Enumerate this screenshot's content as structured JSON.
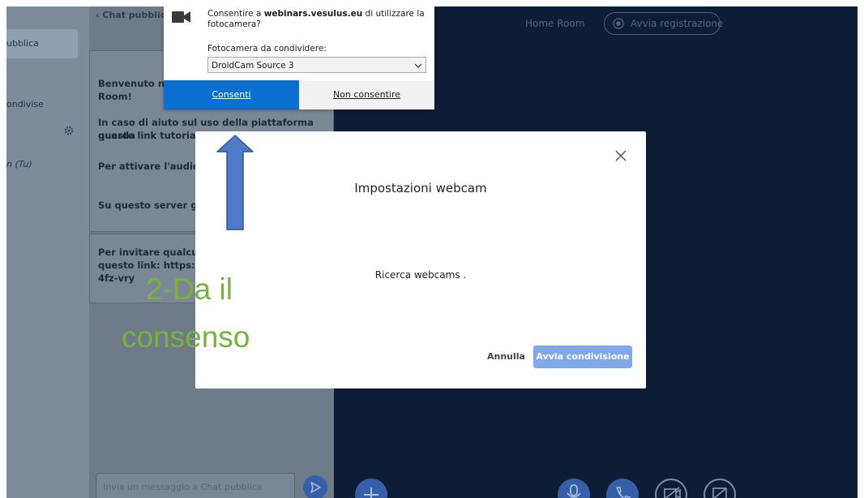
{
  "sidebar": {
    "chat_label": "ubblica",
    "notes_label": "ondivise",
    "user_label": "n (Tu)"
  },
  "chat": {
    "back_label": "Chat pubblica",
    "messages": [
      {
        "text": "Benvenuto nel"
      },
      {
        "text": "Room!"
      },
      {
        "text": "In caso di aiuto sul uso della piattaforma guarda"
      },
      {
        "text": "questo link tutorial vi"
      },
      {
        "text": "Per attivare l'audio pr"
      },
      {
        "text": "Su questo server gira"
      }
    ],
    "invite": {
      "line1": "Per invitare qualcuno",
      "line2": "questo link: https://w",
      "line3": "4fz-vry"
    },
    "input_placeholder": "Invia un messaggio a Chat pubblica"
  },
  "main": {
    "room_name": "Home Room",
    "record_label": "Avvia registrazione"
  },
  "permission": {
    "question_prefix": "Consentire a ",
    "question_domain": "webinars.vesulus.eu",
    "question_suffix": " di utilizzare la fotocamera?",
    "camera_label": "Fotocamera da condividere:",
    "selected_camera": "DroidCam Source 3",
    "allow_label": "Consenti",
    "deny_label": "Non consentire"
  },
  "modal": {
    "title": "Impostazioni webcam",
    "searching": "Ricerca webcams .",
    "cancel_label": "Annulla",
    "share_label": "Avvia condivisione"
  },
  "annotation": {
    "line1": "2-Da il",
    "line2": "consenso"
  },
  "colors": {
    "brand_blue": "#365fa8",
    "allow_blue": "#0a6fd1",
    "annotation_green": "#76b33c",
    "dark_bg": "#0d1d36"
  }
}
